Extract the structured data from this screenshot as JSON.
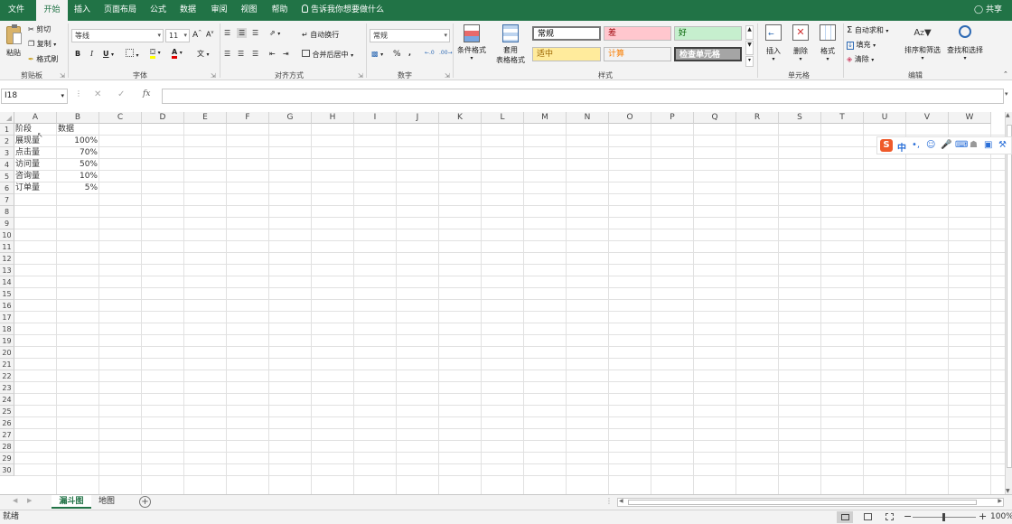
{
  "menu": {
    "tabs": [
      "文件",
      "开始",
      "插入",
      "页面布局",
      "公式",
      "数据",
      "审阅",
      "视图",
      "帮助"
    ],
    "active": "开始",
    "tell_me": "告诉我你想要做什么",
    "share": "共享"
  },
  "ribbon": {
    "clipboard": {
      "paste": "粘贴",
      "cut": "剪切",
      "copy": "复制",
      "format_painter": "格式刷",
      "label": "剪贴板"
    },
    "font": {
      "name": "等线",
      "size": "11",
      "bold": "B",
      "italic": "I",
      "underline": "U",
      "label": "字体"
    },
    "alignment": {
      "wrap": "自动换行",
      "merge": "合并后居中",
      "label": "对齐方式"
    },
    "number": {
      "format": "常规",
      "percent": "%",
      "comma": ",",
      "label": "数字"
    },
    "styles": {
      "conditional": "条件格式",
      "table_line1": "套用",
      "table_line2": "表格格式",
      "boxes": [
        {
          "text": "常规",
          "bg": "#ffffff",
          "fg": "#000000"
        },
        {
          "text": "差",
          "bg": "#ffc7ce",
          "fg": "#9c0006"
        },
        {
          "text": "好",
          "bg": "#c6efce",
          "fg": "#006100"
        },
        {
          "text": "适中",
          "bg": "#ffeb9c",
          "fg": "#9c6500"
        },
        {
          "text": "计算",
          "bg": "#f2f2f2",
          "fg": "#fa7d00"
        },
        {
          "text": "检查单元格",
          "bg": "#a5a5a5",
          "fg": "#ffffff"
        }
      ],
      "label": "样式"
    },
    "cells": {
      "insert": "插入",
      "delete": "删除",
      "format": "格式",
      "label": "单元格"
    },
    "editing": {
      "autosum": "自动求和",
      "fill": "填充",
      "clear": "清除",
      "sort": "排序和筛选",
      "find": "查找和选择",
      "label": "编辑"
    }
  },
  "formula_bar": {
    "name_box": "I18",
    "fx": "fx",
    "value": ""
  },
  "grid": {
    "columns": [
      "A",
      "B",
      "C",
      "D",
      "E",
      "F",
      "G",
      "H",
      "I",
      "J",
      "K",
      "L",
      "M",
      "N",
      "O",
      "P",
      "Q",
      "R",
      "S",
      "T",
      "U",
      "V",
      "W"
    ],
    "row_count": 30,
    "cells": [
      {
        "ref": "A1",
        "value": "阶段",
        "align": "left"
      },
      {
        "ref": "B1",
        "value": "数据",
        "align": "left"
      },
      {
        "ref": "A2",
        "value": "展现量",
        "align": "left"
      },
      {
        "ref": "B2",
        "value": "100%",
        "align": "right"
      },
      {
        "ref": "A3",
        "value": "点击量",
        "align": "left"
      },
      {
        "ref": "B3",
        "value": "70%",
        "align": "right"
      },
      {
        "ref": "A4",
        "value": "访问量",
        "align": "left"
      },
      {
        "ref": "B4",
        "value": "50%",
        "align": "right"
      },
      {
        "ref": "A5",
        "value": "咨询量",
        "align": "left"
      },
      {
        "ref": "B5",
        "value": "10%",
        "align": "right"
      },
      {
        "ref": "A6",
        "value": "订单量",
        "align": "left"
      },
      {
        "ref": "B6",
        "value": "5%",
        "align": "right"
      }
    ]
  },
  "sheets": {
    "tabs": [
      "漏斗图",
      "地图"
    ],
    "active": "漏斗图"
  },
  "status": {
    "text": "就绪",
    "zoom": "100%"
  },
  "ime": {
    "label": "中"
  }
}
